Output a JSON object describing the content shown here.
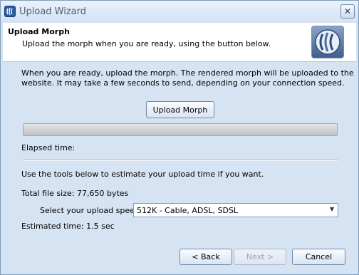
{
  "window": {
    "title": "Upload Wizard",
    "close_glyph": "✕"
  },
  "header": {
    "title": "Upload Morph",
    "subtitle": "Upload the morph when you are ready, using the button below."
  },
  "main": {
    "intro_line1": "When you are ready, upload the morph.  The rendered morph will be uploaded to the",
    "intro_line2": "website.  It may take a few seconds to send, depending on your connection speed.",
    "upload_button": "Upload Morph",
    "progress": 0,
    "elapsed_label": "Elapsed time:",
    "estimate_intro": "Use the tools below to estimate your upload time if you want.",
    "file_size": "Total file size: 77,650 bytes",
    "speed_label": "Select your upload speed:",
    "speed_selected": "512K - Cable, ADSL, SDSL",
    "estimated_time": "Estimated time: 1.5 sec"
  },
  "footer": {
    "back_button": "< Back",
    "next_button": "Next >",
    "cancel_button": "Cancel"
  },
  "icons": {
    "app": "app-icon",
    "close": "close-icon",
    "logo": "morph-logo-icon",
    "dropdown": "chevron-down-icon"
  },
  "colors": {
    "title_bg": "#d4e2f4",
    "panel_bg": "#d6e3f3",
    "header_bg": "#ffffff",
    "progress_fill": "#2e9e2e"
  }
}
